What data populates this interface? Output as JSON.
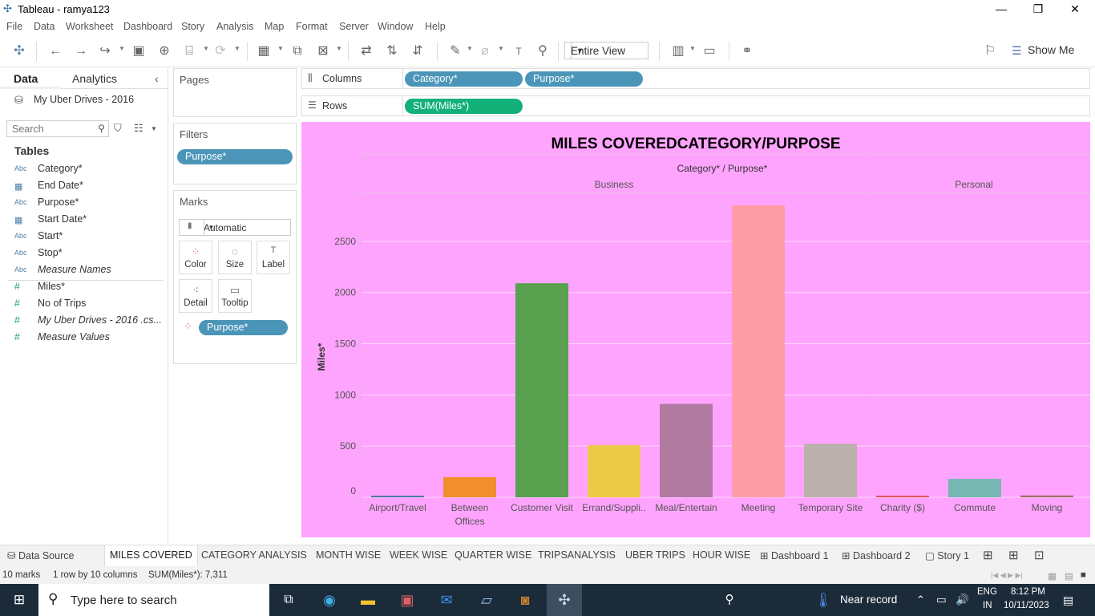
{
  "window": {
    "title": "Tableau - ramya123"
  },
  "menu": [
    "File",
    "Data",
    "Worksheet",
    "Dashboard",
    "Story",
    "Analysis",
    "Map",
    "Format",
    "Server",
    "Window",
    "Help"
  ],
  "toolbar": {
    "fit": "Entire View",
    "show_me": "Show Me"
  },
  "left_panel": {
    "tab_data": "Data",
    "tab_analytics": "Analytics",
    "data_source": "My Uber Drives - 2016",
    "search_placeholder": "Search",
    "tables_heading": "Tables",
    "fields": [
      {
        "type": "Abc",
        "name": "Category*",
        "kind": "dim"
      },
      {
        "type": "date",
        "name": "End Date*",
        "kind": "dim"
      },
      {
        "type": "Abc",
        "name": "Purpose*",
        "kind": "dim"
      },
      {
        "type": "date",
        "name": "Start Date*",
        "kind": "dim"
      },
      {
        "type": "Abc",
        "name": "Start*",
        "kind": "dim"
      },
      {
        "type": "Abc",
        "name": "Stop*",
        "kind": "dim"
      },
      {
        "type": "Abc",
        "name": "Measure Names",
        "kind": "dim",
        "italic": true
      },
      {
        "type": "#",
        "name": "Miles*",
        "kind": "meas"
      },
      {
        "type": "#",
        "name": "No of Trips",
        "kind": "meas"
      },
      {
        "type": "#",
        "name": "My Uber Drives - 2016 .cs...",
        "kind": "meas",
        "italic": true
      },
      {
        "type": "#",
        "name": "Measure Values",
        "kind": "meas",
        "italic": true
      }
    ]
  },
  "cards": {
    "pages": "Pages",
    "filters": "Filters",
    "filter_pill": "Purpose*",
    "marks": "Marks",
    "mark_type": "Automatic",
    "mark_buttons": [
      "Color",
      "Size",
      "Label",
      "Detail",
      "Tooltip"
    ],
    "marks_pill": "Purpose*"
  },
  "shelves": {
    "columns_label": "Columns",
    "columns_pills": [
      "Category*",
      "Purpose*"
    ],
    "rows_label": "Rows",
    "rows_pills": [
      "SUM(Miles*)"
    ]
  },
  "chart_data": {
    "type": "bar",
    "title": "MILES COVEREDCATEGORY/PURPOSE",
    "header": "Category* / Purpose*",
    "ylabel": "Miles*",
    "ylim": [
      0,
      2900
    ],
    "yticks": [
      0,
      500,
      1000,
      1500,
      2000,
      2500
    ],
    "groups": [
      {
        "name": "Business",
        "categories": [
          "Airport/Travel",
          "Between Offices",
          "Customer Visit",
          "Errand/Suppli..",
          "Meal/Entertain",
          "Meeting",
          "Temporary Site"
        ]
      },
      {
        "name": "Personal",
        "categories": [
          "Charity ($)",
          "Commute",
          "Moving"
        ]
      }
    ],
    "categories": [
      "Airport/Travel",
      "Between Offices",
      "Customer Visit",
      "Errand/Suppli..",
      "Meal/Entertain",
      "Meeting",
      "Temporary Site",
      "Charity ($)",
      "Commute",
      "Moving"
    ],
    "values": [
      16,
      197,
      2090,
      508,
      912,
      2851,
      523,
      16,
      180,
      18
    ],
    "colors": [
      "#4e79a7",
      "#f28e2b",
      "#59a14f",
      "#edc948",
      "#b07aa1",
      "#ff9da7",
      "#bab0ac",
      "#e15759",
      "#76b7b2",
      "#9c755f"
    ],
    "background": "#ffa4fe",
    "grid": true
  },
  "sheet_tabs": {
    "data_source": "Data Source",
    "tabs": [
      "MILES COVERED",
      "CATEGORY ANALYSIS",
      "MONTH WISE",
      "WEEK WISE",
      "QUARTER WISE",
      "TRIPSANALYSIS",
      "UBER TRIPS",
      "HOUR WISE"
    ],
    "dashboards": [
      "Dashboard 1",
      "Dashboard 2"
    ],
    "story": "Story 1"
  },
  "status": {
    "marks": "10 marks",
    "dims": "1 row by 10 columns",
    "sum": "SUM(Miles*): 7,311"
  },
  "taskbar": {
    "search_placeholder": "Type here to search",
    "weather": "Near record",
    "lang1": "ENG",
    "lang2": "IN",
    "time": "8:12 PM",
    "date": "10/11/2023"
  }
}
